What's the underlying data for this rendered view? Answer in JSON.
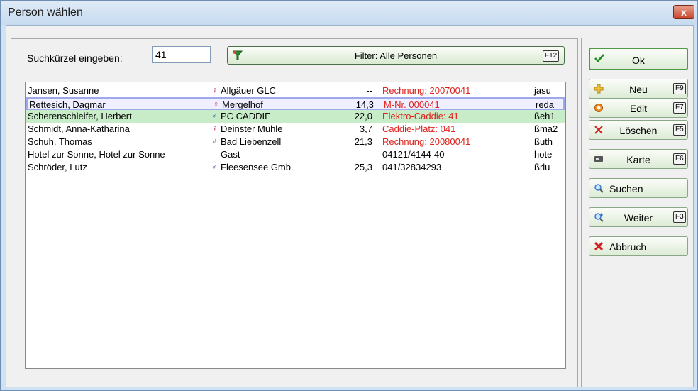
{
  "window": {
    "title": "Person wählen",
    "close_label": "x"
  },
  "search": {
    "label": "Suchkürzel eingeben:",
    "value": "41"
  },
  "filter": {
    "label": "Filter: Alle Personen",
    "key": "F12"
  },
  "persons": [
    {
      "name": "Jansen, Susanne",
      "gender": "female",
      "club": "Allgäuer GLC",
      "hcp": "--",
      "info": "Rechnung:  20070041",
      "info_red": true,
      "code": "jasu",
      "state": ""
    },
    {
      "name": "Rettesich, Dagmar",
      "gender": "female",
      "club": "Mergelhof",
      "hcp": "14,3",
      "info": "M-Nr. 000041",
      "info_red": true,
      "code": "reda",
      "state": "selected"
    },
    {
      "name": "Scherenschleifer, Herbert",
      "gender": "male",
      "club": "PC CADDIE",
      "hcp": "22,0",
      "info": "Elektro-Caddie: 41",
      "info_red": true,
      "code": "ßeh1",
      "state": "highlight"
    },
    {
      "name": "Schmidt, Anna-Katharina",
      "gender": "female",
      "club": "Deinster Mühle",
      "hcp": "3,7",
      "info": "Caddie-Platz: 041",
      "info_red": true,
      "code": "ßma2",
      "state": ""
    },
    {
      "name": "Schuh, Thomas",
      "gender": "male",
      "club": "Bad Liebenzell",
      "hcp": "21,3",
      "info": "Rechnung:  20080041",
      "info_red": true,
      "code": "ßuth",
      "state": ""
    },
    {
      "name": "Hotel zur Sonne, Hotel zur Sonne",
      "gender": "",
      "club": "Gast",
      "hcp": "",
      "info": "04121/4144-40",
      "info_red": false,
      "code": "hote",
      "state": ""
    },
    {
      "name": "Schröder, Lutz",
      "gender": "male",
      "club": "Fleesensee Gmb",
      "hcp": "25,3",
      "info": "041/32834293",
      "info_red": false,
      "code": "ßrlu",
      "state": ""
    }
  ],
  "buttons": [
    {
      "name": "ok-button",
      "label": "Ok",
      "key": "",
      "icon": "check-icon"
    },
    {
      "name": "new-button",
      "label": "Neu",
      "key": "F9",
      "icon": "plus-icon"
    },
    {
      "name": "edit-button",
      "label": "Edit",
      "key": "F7",
      "icon": "edit-icon"
    },
    {
      "name": "delete-button",
      "label": "Löschen",
      "key": "F5",
      "icon": "delete-icon"
    },
    {
      "name": "card-button",
      "label": "Karte",
      "key": "F6",
      "icon": "card-icon"
    },
    {
      "name": "search-button",
      "label": "Suchen",
      "key": "",
      "icon": "magnifier-icon"
    },
    {
      "name": "next-button",
      "label": "Weiter",
      "key": "F3",
      "icon": "magnifier-next-icon"
    },
    {
      "name": "cancel-button",
      "label": "Abbruch",
      "key": "",
      "icon": "cancel-icon"
    }
  ],
  "colors": {
    "red_text": "#e0201b",
    "female": "#c0267a",
    "male": "#1f3f9a",
    "highlight": "#c8ecc8"
  }
}
